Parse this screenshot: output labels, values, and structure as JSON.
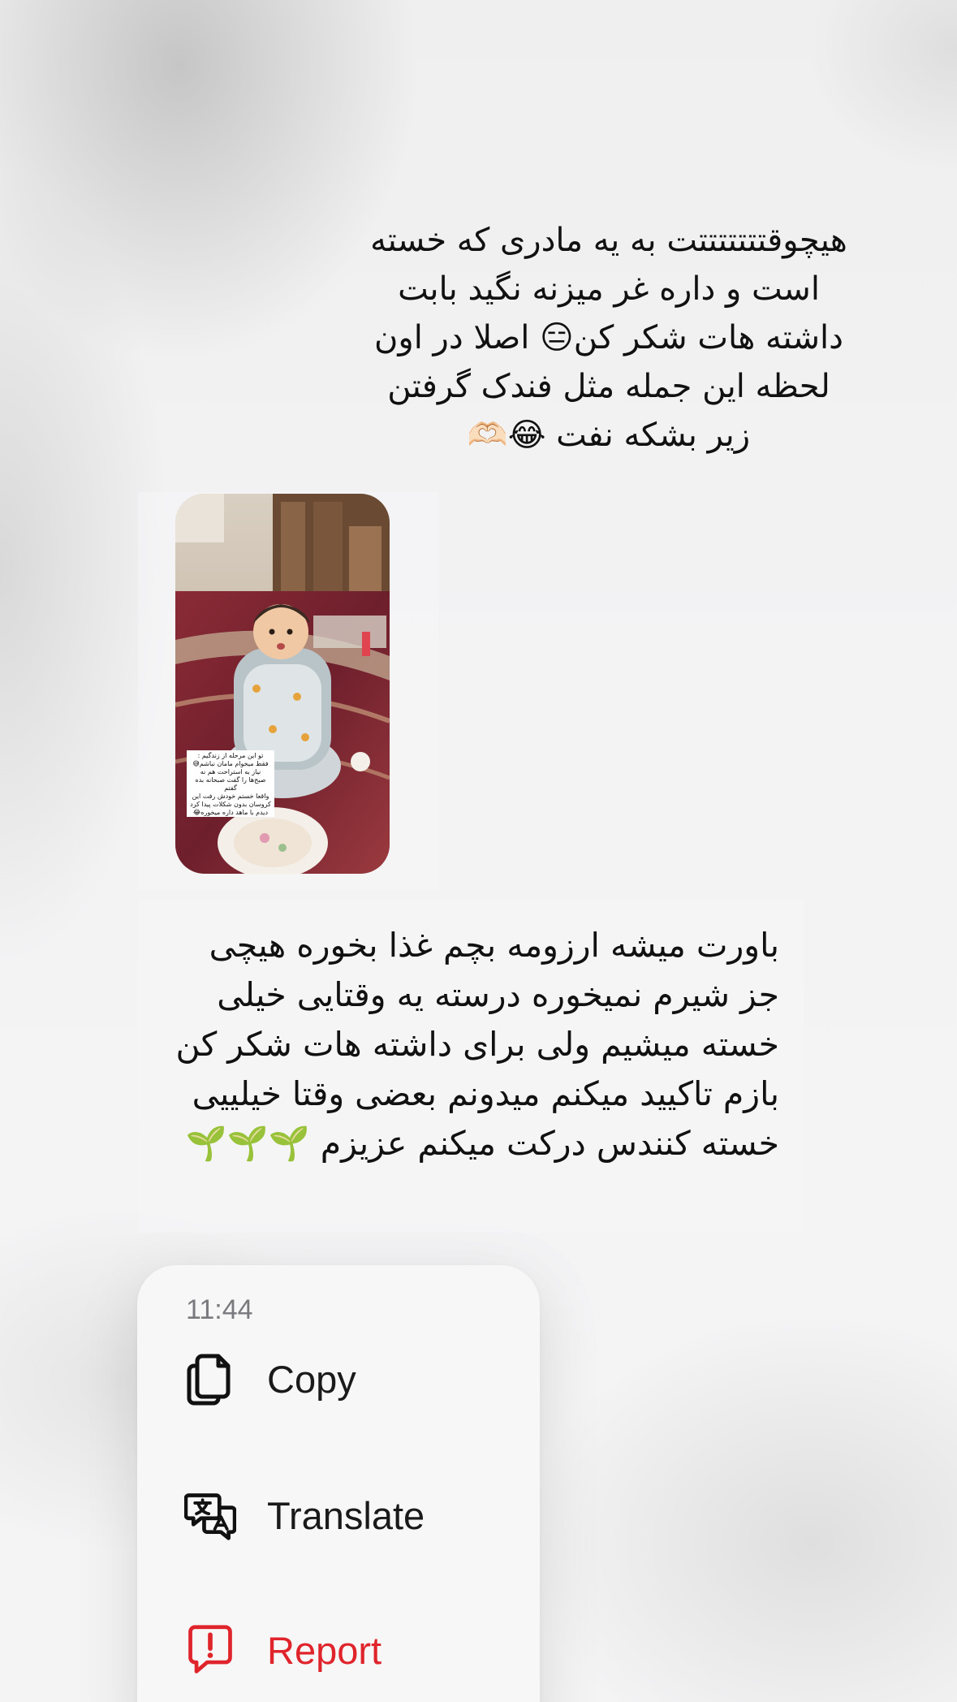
{
  "messages": {
    "text1": "هیچوقتتتتتتتت به یه مادری که خسته است و داره غر میزنه نگید بابت داشته هات شکر کن😑 اصلا در اون لحظه این جمله مثل فندک گرفتن زیر بشکه نفت 😂🫶🏻",
    "media_caption": [
      "تو این مرحله از زندگیم :",
      "فقط میخوام مامان نباشم😅",
      "نیاز به استراحت هم نه",
      "صبح‌ها را گفت صبحانه بده گفتم",
      "واقعا خستم خودش رفت این",
      "کروسان بدون شکلات پیدا کرد",
      "دیدم با ماهد داره میخوره😂"
    ],
    "text2": "باورت میشه ارزومه بچم غذا بخوره هیچی جز شیرم نمیخوره درسته یه وقتایی خیلی خسته میشیم ولی برای داشته هات شکر کن بازم تاکیید میکنم میدونم بعضی وقتا خیلییی خسته کنندس درکت میکنم عزیزم 🌱🌱🌱"
  },
  "context_menu": {
    "time": "11:44",
    "copy_label": "Copy",
    "translate_label": "Translate",
    "report_label": "Report"
  },
  "colors": {
    "report": "#e0242b",
    "menu_background": "#f7f7f7",
    "time_text": "#7a7a7e"
  },
  "icons": {
    "copy": "copy-icon",
    "translate": "translate-icon",
    "report": "report-icon"
  }
}
